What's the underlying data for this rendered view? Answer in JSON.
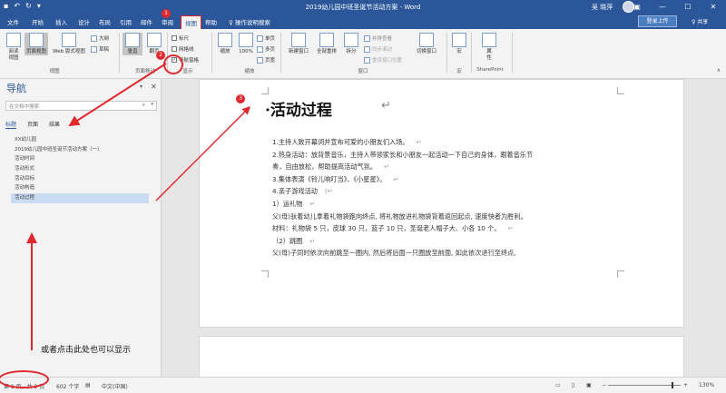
{
  "titlebar": {
    "doc_title": "2019幼儿园中班圣诞节活动方案 - Word",
    "user": "吴 晓萍",
    "signin": "登录上传",
    "share": "♀ 共享"
  },
  "tabs": [
    "文件",
    "开始",
    "插入",
    "设计",
    "布局",
    "引用",
    "邮件",
    "审阅",
    "视图",
    "帮助"
  ],
  "tell_me": "操作说明搜索",
  "ribbon": {
    "read_mode": "阅读\n视图",
    "print_layout": "页面视图",
    "web_layout": "Web 版式视图",
    "outline": "大纲",
    "draft": "草稿",
    "group_views": "视图",
    "vertical": "垂直",
    "side_to_side": "翻页",
    "group_page_move": "页面移动",
    "ruler": "标尺",
    "gridlines": "网格线",
    "nav_pane": "导航窗格",
    "group_show": "显示",
    "zoom": "缩放",
    "zoom100": "100%",
    "one_page": "单页",
    "multi_page": "多页",
    "page_width": "页宽",
    "group_zoom": "缩放",
    "new_window": "新建窗口",
    "arrange_all": "全部重排",
    "split": "拆分",
    "side_by_side": "并排查看",
    "sync_scroll": "同步滚动",
    "reset_pos": "重设窗口位置",
    "switch_windows": "切换窗口",
    "group_window": "窗口",
    "macros": "宏",
    "group_macros": "宏",
    "properties": "属\n性",
    "group_sharepoint": "SharePoint"
  },
  "nav": {
    "title": "导航",
    "search_placeholder": "在文档中搜索",
    "tabs": [
      "标题",
      "页面",
      "结果"
    ],
    "headings": [
      "XX幼儿园",
      "2019幼儿园中班圣诞节活动方案（一）",
      "活动时间",
      "活动形式",
      "活动目标",
      "活动构造",
      "活动过程"
    ]
  },
  "doc": {
    "heading": "·活动过程",
    "lines": [
      "1.主持人致开幕词并宣布可爱的小朋友们入场。",
      "2.热身活动：放背景音乐，主持人带领家长和小朋友一起活动一下自己的身体，跟着音乐节",
      "奏，自由放松，帮助提高活动气氛。",
      "3.集体表演《铃儿响叮当》、《小星星》。",
      "4.亲子游戏活动",
      "1）运礼物",
      "父(母)驮着幼儿拿着礼物袋跑向终点, 将礼物放进礼物袋背着返回起点, 速度快者为胜利。",
      "材料：礼物袋 5 只，皮球 30 只，篮子 10 只，圣诞老人帽子大、小各 10 个。",
      "（2）跳圈",
      "父(母)子同时依次向前跳至一圈内, 然后将后面一只圈放至前面, 如此依次进行至终点,"
    ]
  },
  "status": {
    "page": "第 1 页，共 2 页",
    "words": "602 个字",
    "lang": "中文(中国)",
    "zoom": "130%"
  },
  "annotation": {
    "note": "或者点击此处也可以显示",
    "markers": [
      "1",
      "2",
      "3"
    ]
  }
}
